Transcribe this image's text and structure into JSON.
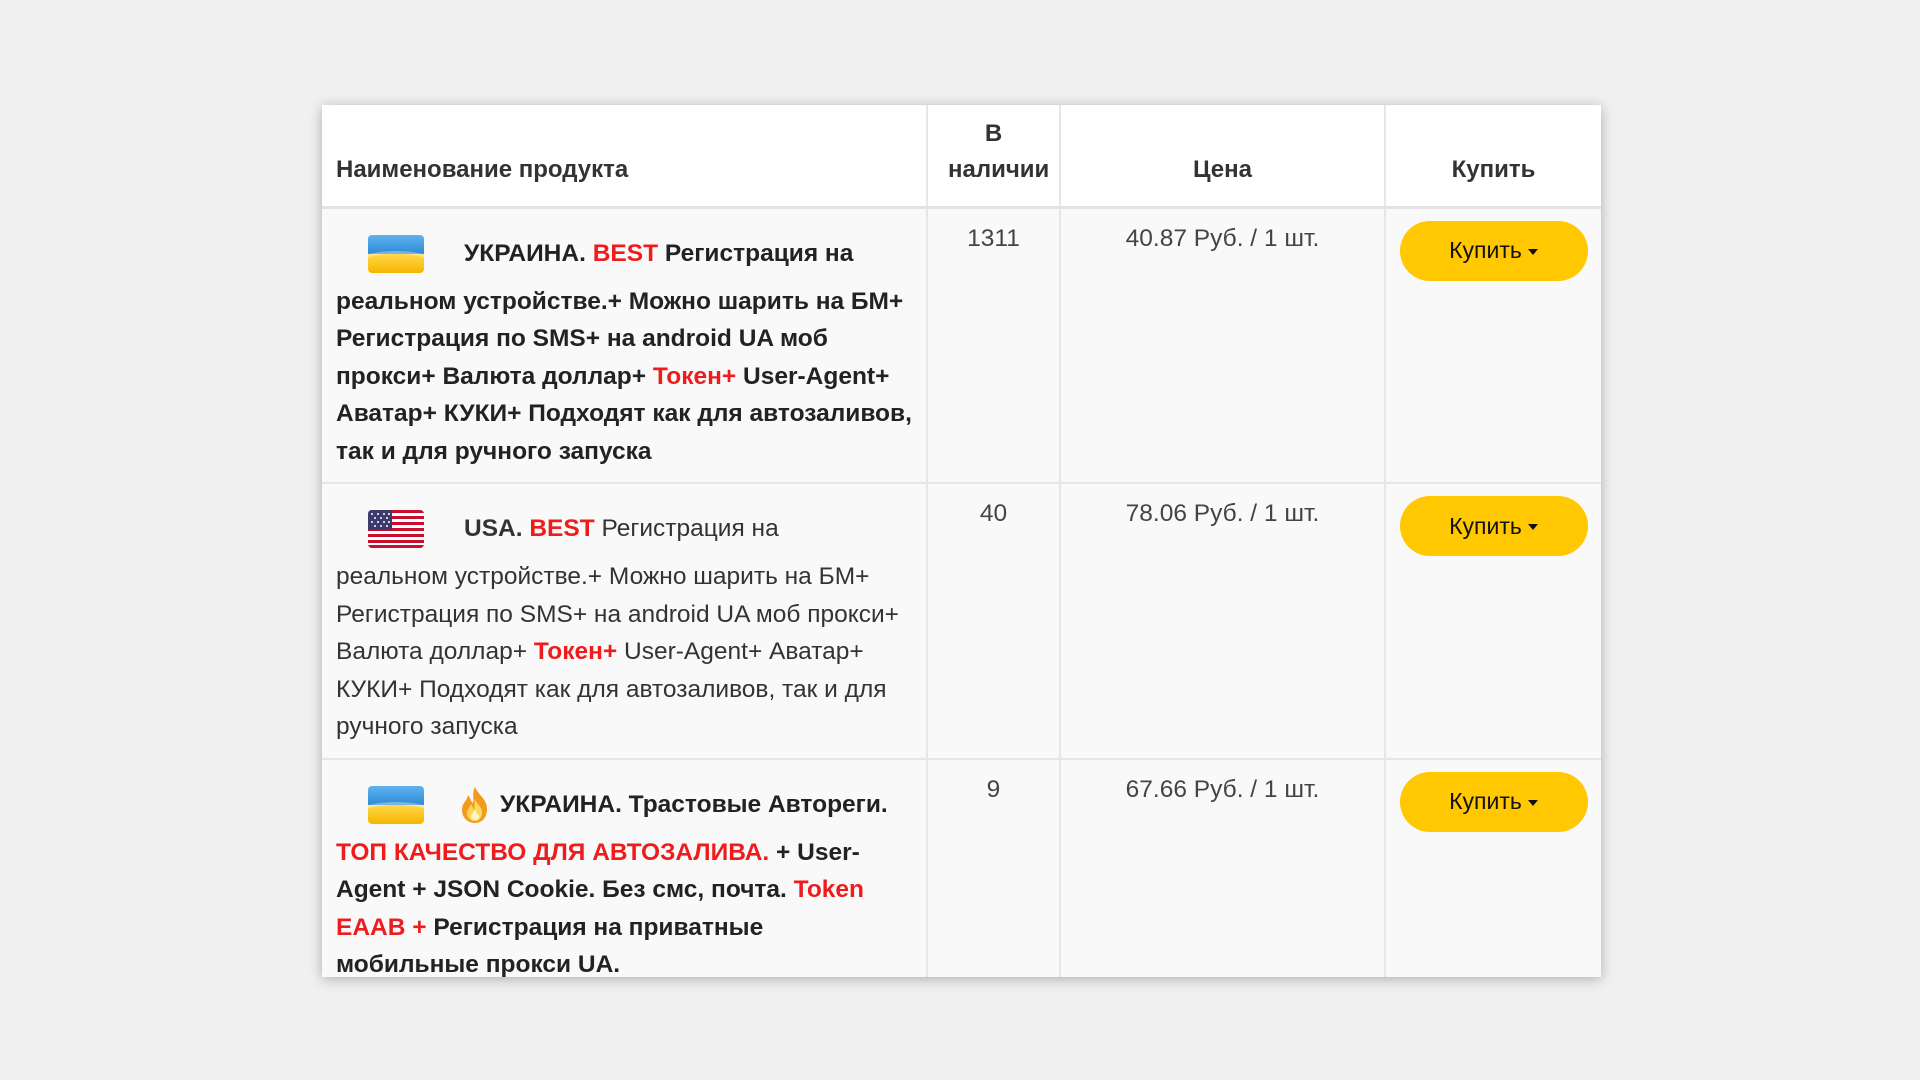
{
  "table": {
    "headers": {
      "name": "Наименование продукта",
      "stock": "В наличии",
      "price": "Цена",
      "buy": "Купить"
    },
    "rows": [
      {
        "flag": "ukraine-flag-icon",
        "country": "УКРАИНА.",
        "best": "BEST",
        "text_a": "Регистрация на реальном устройстве.+ Можно шарить на БМ+ Регистрация по SMS+ на android UA моб прокси+ Валюта доллар+",
        "token": "Токен+",
        "text_b": "User-Agent+ Аватар+ КУКИ+ Подходят как для автозаливов, так и для ручного запуска",
        "stock": "1311",
        "price": "40.87 Руб. / 1 шт.",
        "buy_label": "Купить"
      },
      {
        "flag": "usa-flag-icon",
        "country": "USA.",
        "best": "BEST",
        "text_a": "Регистрация на реальном устройстве.+ Можно шарить на БМ+ Регистрация по SMS+ на android UA моб прокси+ Валюта доллар+",
        "token": "Токен+",
        "text_b": "User-Agent+ Аватар+ КУКИ+ Подходят как для автозаливов, так и для ручного запуска",
        "stock": "40",
        "price": "78.06 Руб. / 1 шт.",
        "buy_label": "Купить"
      },
      {
        "flag": "ukraine-flag-icon",
        "icon": "fire-icon",
        "title": "УКРАИНА. Трастовые Автореги.",
        "top_quality": "ТОП КАЧЕСТВО ДЛЯ АВТОЗАЛИВА.",
        "text_a": "+ User-Agent + JSON Cookie. Без смс, почта.",
        "token": "Token EAAB +",
        "text_b": "Регистрация на приватные мобильные прокси UA.",
        "stock": "9",
        "price": "67.66 Руб. / 1 шт.",
        "buy_label": "Купить"
      }
    ]
  },
  "colors": {
    "accent_button": "#ffc800",
    "highlight_red": "#ee1c1c",
    "row_background": "#f9f9f9",
    "page_background": "#f0f0f0"
  }
}
